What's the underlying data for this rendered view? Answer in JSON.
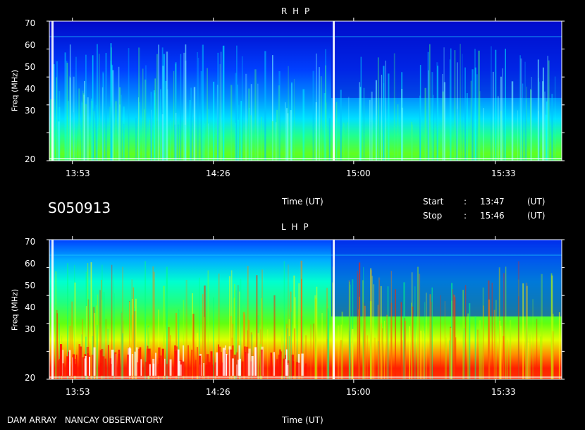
{
  "chart_data": [
    {
      "type": "heatmap",
      "title": "R H P",
      "ylabel": "Freq (MHz)",
      "xlabel": "Time (UT)",
      "yticks": [
        20,
        30,
        40,
        50,
        60,
        70
      ],
      "xticks": [
        "13:53",
        "14:26",
        "15:00",
        "15:33"
      ],
      "ylim": [
        20,
        70
      ],
      "xlim": [
        "13:47",
        "15:46"
      ],
      "colormap": [
        "#0000c8",
        "#0030ff",
        "#00a0ff",
        "#00f0ff",
        "#00ff80",
        "#40ff00",
        "#ffff00",
        "#ff8000",
        "#ff0000",
        "#ffffff"
      ]
    },
    {
      "type": "heatmap",
      "title": "L H P",
      "ylabel": "Freq (MHz)",
      "xlabel": "Time (UT)",
      "yticks": [
        20,
        30,
        40,
        50,
        60,
        70
      ],
      "xticks": [
        "13:53",
        "14:26",
        "15:00",
        "15:33"
      ],
      "ylim": [
        20,
        70
      ],
      "xlim": [
        "13:47",
        "15:46"
      ],
      "colormap": [
        "#0000c8",
        "#0030ff",
        "#00a0ff",
        "#00f0ff",
        "#00ff80",
        "#40ff00",
        "#ffff00",
        "#ff8000",
        "#ff0000",
        "#ffffff"
      ]
    }
  ],
  "header": {
    "session": "S050913",
    "start_label": "Start",
    "start_colon": ":",
    "start_time": "13:47",
    "start_unit": "(UT)",
    "stop_label": "Stop",
    "stop_colon": ":",
    "stop_time": "15:46",
    "stop_unit": "(UT)"
  },
  "footer": {
    "station": "DAM ARRAY   NANCAY OBSERVATORY"
  }
}
